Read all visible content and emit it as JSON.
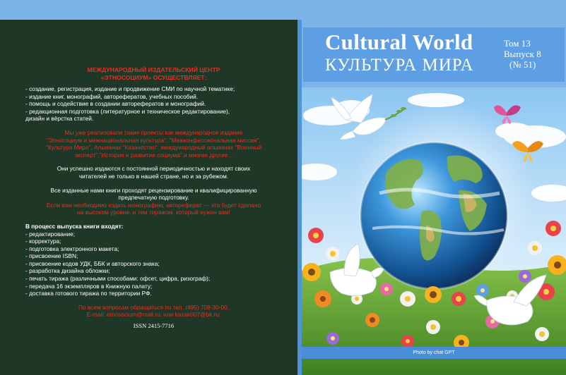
{
  "back": {
    "heading1": "МЕЖДУНАРОДНЫЙ ИЗДАТЕЛЬСКИЙ ЦЕНТР",
    "heading2": "«ЭТНОСОЦИУМ» ОСУЩЕСТВЛЯЕТ:",
    "services": [
      "- создание, регистрация, издание и продвижение СМИ по научной тематике;",
      "- издание книг, монографий, авторефератов, учебных пособий.",
      "- помощь и содействие в создании авторефератов и монографий.",
      "- редакционная подготовка (литературное и техническое редактирование),",
      "дизайн и вёрстка статей."
    ],
    "projects": [
      "Мы уже реализовали такие проекты как международное издание",
      "\"Этносоциум и межнациональная культура\",  \"Межконфессиональная миссия\",",
      "\"Культура Мира\", Альманах \"Казачество\", международный альманах \"Военный",
      "эксперт\",\"История и развитие социума\" и многие другие..."
    ],
    "success": [
      "Они успешно издаются с постоянной периодичностью и находят своих",
      "читателей не только в нашей стране, но и за рубежом."
    ],
    "review": [
      "Все изданные нами книги проходят рецензирование и квалифицированную",
      "предпечатную подготовку."
    ],
    "offer": [
      "Если вам необходимо издать монографию, автореферат — это будет сделано",
      "на высоком уровне, и тем тиражом, который нужен вам!"
    ],
    "process_title": "В процесс выпуска книги входят:",
    "process": [
      "- редактирование;",
      "- корректура;",
      "- подготовка электронного макета;",
      "- присвоение ISBN;",
      "- присвоение кодов УДК, ББК и авторского знака;",
      "- разработка дизайна обложки;",
      "- печать тиража (различными способами: офсет, цифра, ризограф);",
      "- передача 16 экземпляров в Книжную палату;",
      "- доставка готового тиража по территории РФ."
    ],
    "contact1": "По всем вопросам обращаться по тел. (495) 708-30-00,",
    "contact2": "E-mail: etnosocium@mail.ru, или kazak007@bk.ru.",
    "isbn": "ISSN 2415-7716"
  },
  "front": {
    "title_en": "Cultural World",
    "title_ru": "КУЛЬТУРА  МИРА",
    "volume": "Том 13",
    "issue": "Выпуск 8",
    "number": "(№ 51)",
    "photo_credit": "Photo by chat GPT"
  },
  "colors": {
    "back_bg": "#1e3727",
    "accent_red": "#e03226",
    "cover_blue": "#7cb4ea",
    "title_blue": "#5d9fe2"
  }
}
